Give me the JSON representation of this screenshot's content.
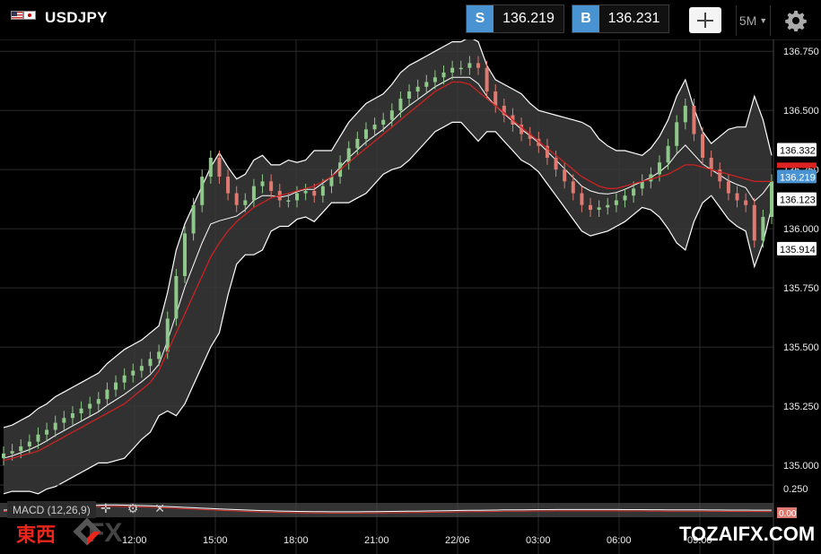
{
  "header": {
    "symbol": "USDJPY",
    "sell_label": "S",
    "sell_price": "136.219",
    "buy_label": "B",
    "buy_price": "136.231",
    "timeframe": "5M",
    "icons": [
      "flag-us-icon",
      "flag-jp-icon",
      "crosshair-icon",
      "caret-down-icon",
      "gear-icon"
    ]
  },
  "macd": {
    "label": "MACD (12,26,9)",
    "axis_top": "0.250",
    "axis_mid": "0.00"
  },
  "watermarks": {
    "left_kanji": "東西",
    "left_fx": "FX",
    "right": "TOZAIFX.COM"
  },
  "colors": {
    "background": "#000000",
    "candle_up": "#8fc98a",
    "candle_down": "#e07a70",
    "band_fill": "#3a3a3a",
    "band_line": "#ffffff",
    "ma_line": "#cc2222",
    "accent_blue": "#4a93d3"
  },
  "chart_data": {
    "type": "candlestick",
    "symbol": "USDJPY",
    "timeframe": "5M",
    "y_ticks": [
      "136.750",
      "136.500",
      "136.250",
      "136.000",
      "135.750",
      "135.500",
      "135.250",
      "135.000"
    ],
    "ylim": [
      134.97,
      136.8
    ],
    "x_ticks": [
      "12:00",
      "15:00",
      "18:00",
      "21:00",
      "22/06",
      "03:00",
      "06:00",
      "09:00"
    ],
    "price_tags": [
      {
        "label": "136.332",
        "style": "white"
      },
      {
        "label": "136.219",
        "style": "blue"
      },
      {
        "label": "136.123",
        "style": "white"
      },
      {
        "label": "135.914",
        "style": "white"
      }
    ],
    "close_series": [
      135.05,
      135.06,
      135.08,
      135.1,
      135.13,
      135.15,
      135.18,
      135.2,
      135.22,
      135.24,
      135.26,
      135.28,
      135.32,
      135.35,
      135.38,
      135.4,
      135.42,
      135.45,
      135.48,
      135.62,
      135.8,
      135.98,
      136.1,
      136.22,
      136.3,
      136.22,
      136.15,
      136.1,
      136.12,
      136.18,
      136.2,
      136.16,
      136.12,
      136.12,
      136.15,
      136.16,
      136.14,
      136.18,
      136.22,
      136.28,
      136.34,
      136.38,
      136.42,
      136.44,
      136.46,
      136.5,
      136.55,
      136.58,
      136.6,
      136.62,
      136.64,
      136.66,
      136.68,
      136.68,
      136.7,
      136.68,
      136.58,
      136.52,
      136.48,
      136.44,
      136.4,
      136.38,
      136.35,
      136.3,
      136.25,
      136.2,
      136.15,
      136.1,
      136.08,
      136.09,
      136.1,
      136.12,
      136.14,
      136.17,
      136.2,
      136.23,
      136.28,
      136.35,
      136.45,
      136.52,
      136.4,
      136.3,
      136.25,
      136.2,
      136.15,
      136.12,
      136.1,
      135.95,
      136.05,
      136.2
    ],
    "ma_series": [
      135.02,
      135.03,
      135.04,
      135.05,
      135.06,
      135.08,
      135.1,
      135.12,
      135.14,
      135.16,
      135.18,
      135.2,
      135.22,
      135.24,
      135.26,
      135.29,
      135.32,
      135.35,
      135.4,
      135.48,
      135.56,
      135.64,
      135.72,
      135.8,
      135.88,
      135.94,
      135.99,
      136.03,
      136.06,
      136.09,
      136.11,
      136.13,
      136.14,
      136.15,
      136.16,
      136.17,
      136.18,
      136.2,
      136.22,
      136.25,
      136.28,
      136.31,
      136.34,
      136.37,
      136.4,
      136.43,
      136.46,
      136.49,
      136.52,
      136.55,
      136.58,
      136.6,
      136.62,
      136.62,
      136.61,
      136.58,
      136.55,
      136.52,
      136.49,
      136.46,
      136.43,
      136.4,
      136.37,
      136.34,
      136.31,
      136.28,
      136.25,
      136.22,
      136.2,
      136.18,
      136.17,
      136.17,
      136.18,
      136.19,
      136.2,
      136.21,
      136.22,
      136.23,
      136.25,
      136.27,
      136.27,
      136.26,
      136.25,
      136.24,
      136.23,
      136.22,
      136.21,
      136.2,
      136.2,
      136.2
    ]
  }
}
